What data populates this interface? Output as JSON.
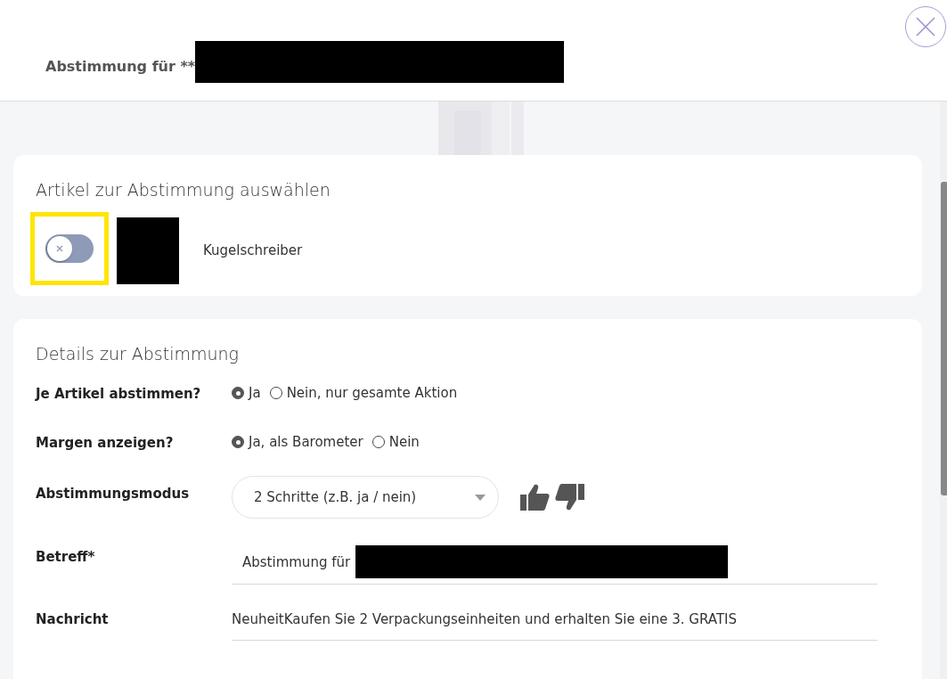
{
  "dialog": {
    "title": "Abstimmung für **"
  },
  "article_card": {
    "heading": "Artikel zur Abstimmung auswählen",
    "articles": [
      {
        "on": false,
        "name": "Kugelschreiber"
      }
    ]
  },
  "details_card": {
    "heading": "Details zur Abstimmung",
    "fields": [
      {
        "kind": "radio",
        "label": "Je Artikel abstimmen?",
        "options": [
          {
            "label": "Ja",
            "selected": true
          },
          {
            "label": "Nein, nur gesamte Aktion",
            "selected": false
          }
        ]
      },
      {
        "kind": "radio",
        "label": "Margen anzeigen?",
        "options": [
          {
            "label": "Ja, als Barometer",
            "selected": true
          },
          {
            "label": "Nein",
            "selected": false
          }
        ]
      },
      {
        "kind": "select",
        "label": "Abstimmungsmodus",
        "value": "2 Schritte (z.B. ja / nein)"
      },
      {
        "kind": "input",
        "label": "Betreff*",
        "value": "Abstimmung für"
      },
      {
        "kind": "text",
        "label": "Nachricht",
        "value": "NeuheitKaufen Sie 2 Verpackungseinheiten und erhalten Sie eine 3. GRATIS"
      }
    ]
  }
}
